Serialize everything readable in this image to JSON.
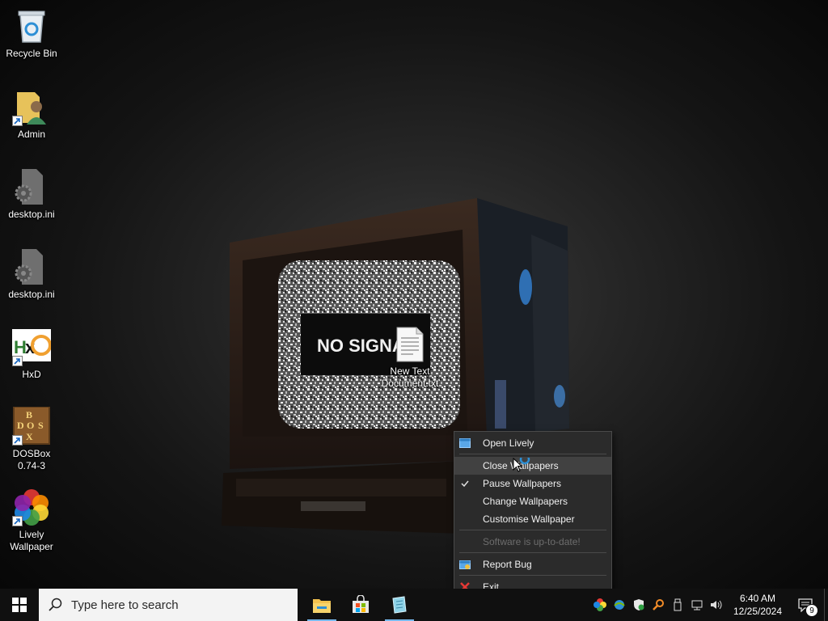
{
  "desktop": {
    "icons": [
      {
        "label": "Recycle Bin",
        "icon": "recycle-bin-icon"
      },
      {
        "label": "Admin",
        "icon": "user-folder-icon"
      },
      {
        "label": "desktop.ini",
        "icon": "settings-file-icon"
      },
      {
        "label": "desktop.ini",
        "icon": "settings-file-icon"
      },
      {
        "label": "HxD",
        "icon": "hxd-icon"
      },
      {
        "label": "DOSBox\n0.74-3",
        "icon": "dosbox-icon"
      },
      {
        "label": "Lively\nWallpaper",
        "icon": "lively-icon"
      }
    ],
    "file": {
      "label": "New Text\nDocument.txt",
      "icon": "text-file-icon"
    },
    "wallpaper_text": "NO SIGNA"
  },
  "context_menu": {
    "items": [
      {
        "label": "Open Lively",
        "icon": "window-icon"
      },
      {
        "label": "Close Wallpapers"
      },
      {
        "label": "Pause Wallpapers",
        "icon": "checkmark-icon"
      },
      {
        "label": "Change Wallpapers"
      },
      {
        "label": "Customise Wallpaper"
      },
      {
        "label": "Software is up-to-date!"
      },
      {
        "label": "Report Bug",
        "icon": "bug-report-icon"
      },
      {
        "label": "Exit",
        "icon": "close-x-icon"
      }
    ]
  },
  "taskbar": {
    "search_placeholder": "Type here to search",
    "apps": [
      "file-explorer-icon",
      "microsoft-store-icon",
      "notepad-icon"
    ],
    "clock": {
      "time": "6:40 AM",
      "date": "12/25/2024"
    },
    "notification_count": "9"
  },
  "colors": {
    "taskbar_bg": "#101010",
    "menu_bg": "#2b2b2b",
    "menu_hover": "#414141",
    "accent": "#76b9ed"
  }
}
